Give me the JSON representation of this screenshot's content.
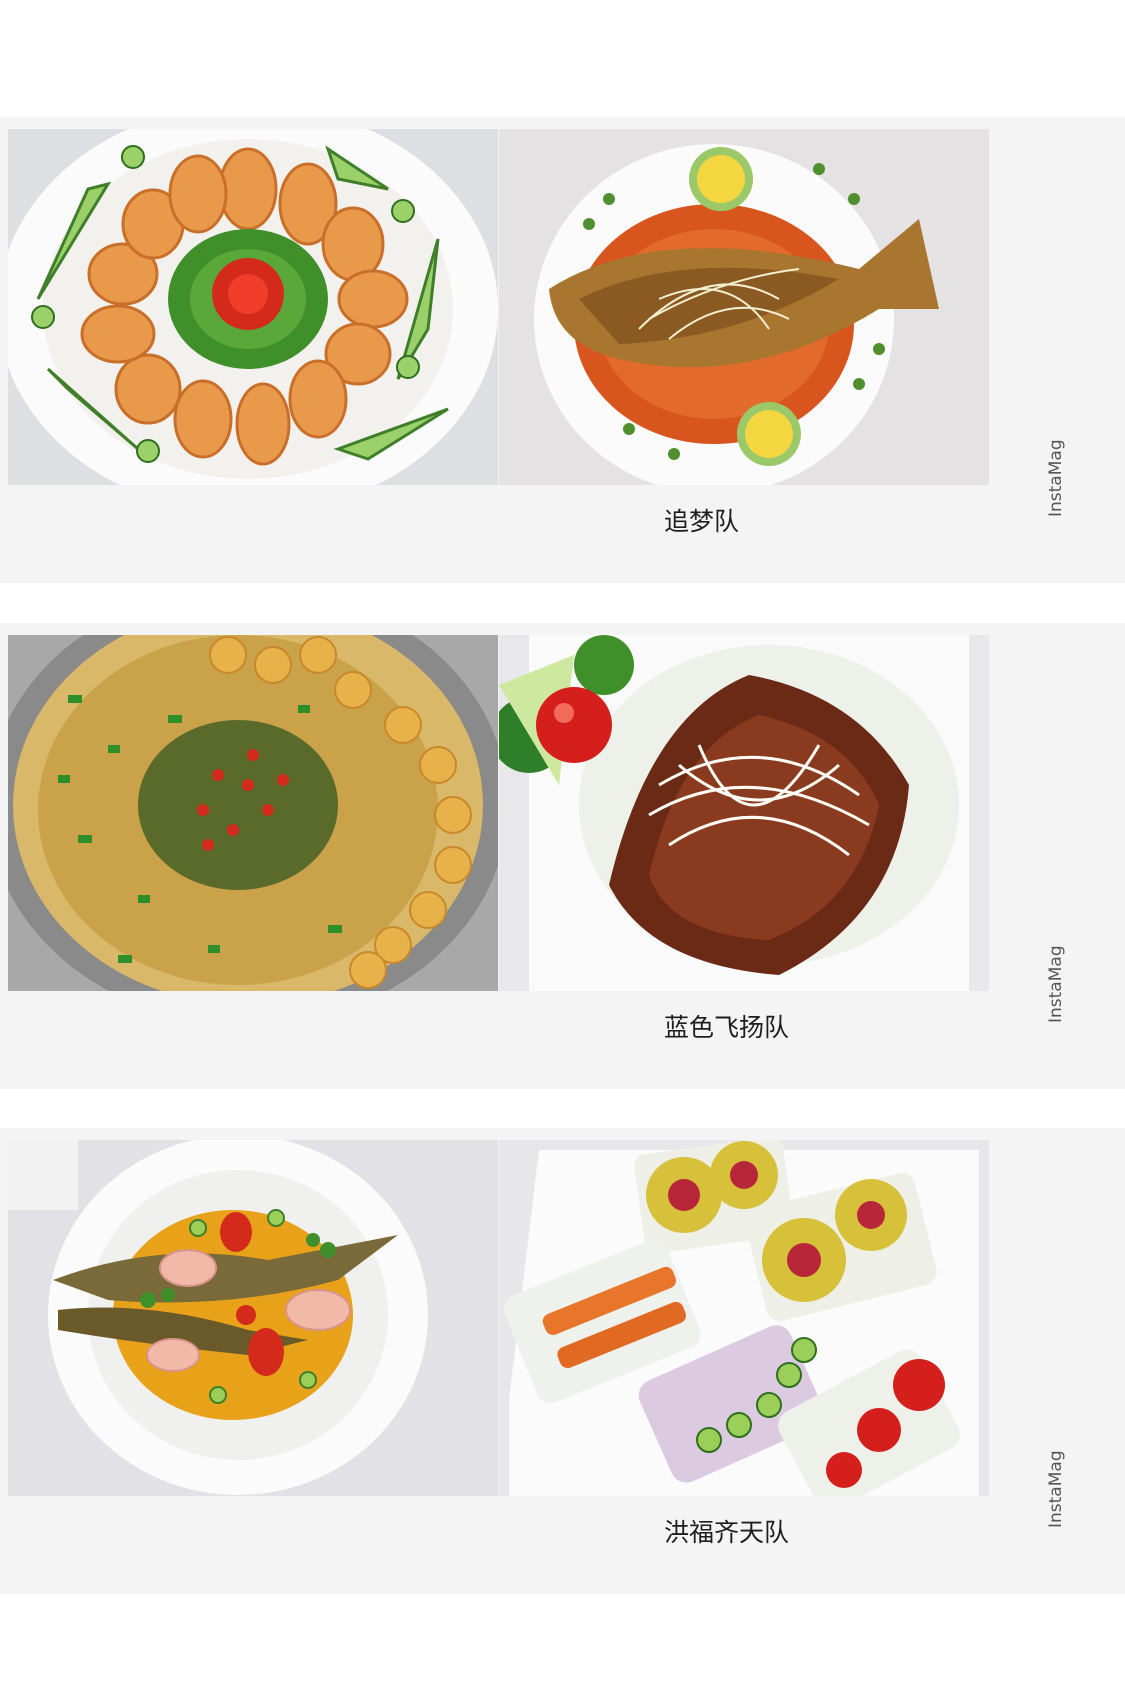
{
  "collage": {
    "watermark": "InstaMag",
    "rows": [
      {
        "caption": "追梦队",
        "photos": [
          {
            "subject": "shrimp platter with tomato rose and cucumber garnish"
          },
          {
            "subject": "braised fish in red sauce with lemon rose garnish"
          }
        ]
      },
      {
        "caption": "蓝色飞扬队",
        "photos": [
          {
            "subject": "pot of pork with chilis, green onion and fish balls"
          },
          {
            "subject": "sweet and sour shredded pork with shredded leek and broccoli"
          }
        ]
      },
      {
        "caption": "洪福齐天队",
        "photos": [
          {
            "subject": "fish in golden broth with cherry tomatoes and okra"
          },
          {
            "subject": "rice paper rolls with kiwi, crab sticks and okra"
          }
        ]
      }
    ]
  }
}
